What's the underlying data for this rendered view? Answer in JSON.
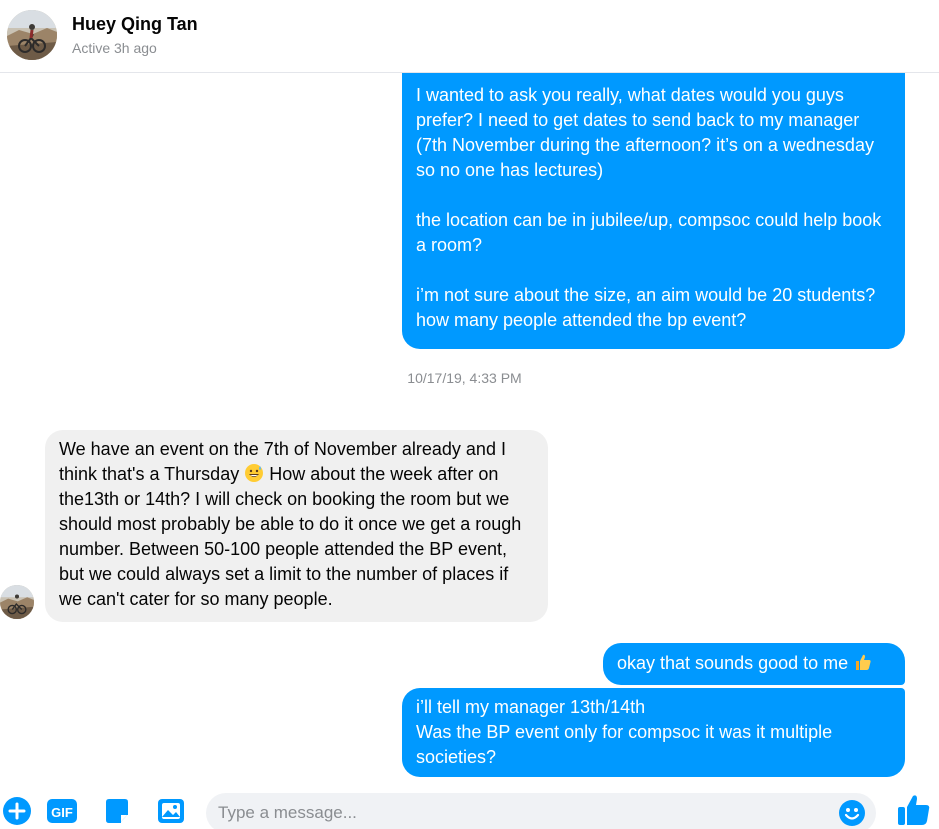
{
  "header": {
    "contact_name": "Huey Qing Tan",
    "status": "Active 3h ago",
    "avatar_icon": "avatar-photo"
  },
  "colors": {
    "accent": "#0099ff",
    "incoming_bubble": "#f0f0f0",
    "timestamp_text": "#8a8d91"
  },
  "messages": [
    {
      "direction": "outgoing",
      "text": "I wanted to ask you really, what dates would you guys prefer? I need to get dates to send back to my manager (7th November during the afternoon? it’s on a wednesday so no one has lectures)\n\nthe location can be in jubilee/up, compsoc could help book a room?\n\ni’m not sure about the size, an aim would be 20 students? how many people attended the bp event?"
    },
    {
      "direction": "incoming",
      "text_before_emoji": "We have an event on the 7th of November already and I think that's a Thursday ",
      "emoji": "grinning-sweat-emoji",
      "text_after_emoji": " How about the week after on the13th or 14th? I will check on booking the room but we should most probably be able to do it once we get a rough number. Between 50-100 people attended the BP event, but we could always set a limit to the number of places if we can't cater for so many people."
    },
    {
      "direction": "outgoing",
      "text": "okay that sounds good to me ",
      "emoji": "thumbs-up-emoji"
    },
    {
      "direction": "outgoing",
      "text": "i’ll tell my manager 13th/14th\nWas the BP event only for compsoc it was it multiple societies?"
    }
  ],
  "timestamp": "10/17/19, 4:33 PM",
  "composer": {
    "placeholder": "Type a message...",
    "value": "",
    "tools": [
      "add-icon",
      "gif-icon",
      "sticker-icon",
      "image-icon"
    ],
    "gif_label": "GIF",
    "emoji_button_icon": "smiley-icon",
    "send_button_icon": "thumbs-up-icon"
  }
}
